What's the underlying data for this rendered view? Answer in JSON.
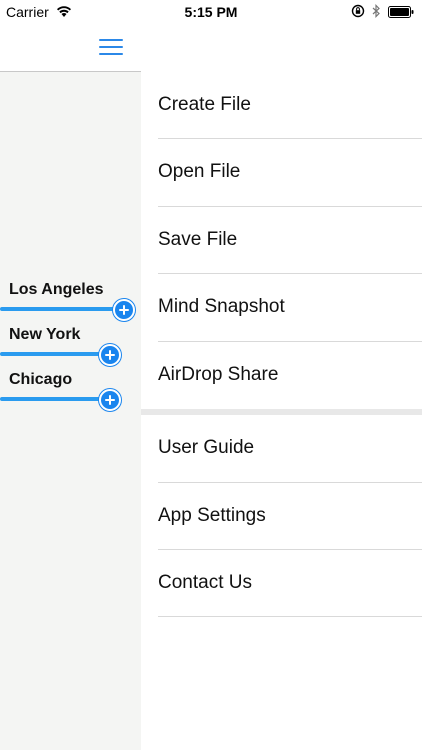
{
  "status_bar": {
    "carrier": "Carrier",
    "time": "5:15 PM",
    "icons": [
      "wifi-icon",
      "rotation-lock-icon",
      "bluetooth-icon",
      "battery-icon"
    ]
  },
  "nav_bar": {
    "menu_icon": "hamburger-icon",
    "accent_color": "#2b88e8"
  },
  "mind_map": {
    "nodes": [
      {
        "label": "Los Angeles"
      },
      {
        "label": "New York"
      },
      {
        "label": "Chicago"
      }
    ],
    "line_color": "#2a9bef",
    "add_button_color": "#1a85ee"
  },
  "menu": {
    "sections": [
      {
        "items": [
          {
            "label": "Create File"
          },
          {
            "label": "Open File"
          },
          {
            "label": "Save File"
          },
          {
            "label": "Mind Snapshot"
          },
          {
            "label": "AirDrop Share"
          }
        ]
      },
      {
        "items": [
          {
            "label": "User Guide"
          },
          {
            "label": "App Settings"
          },
          {
            "label": "Contact Us"
          }
        ]
      }
    ]
  }
}
